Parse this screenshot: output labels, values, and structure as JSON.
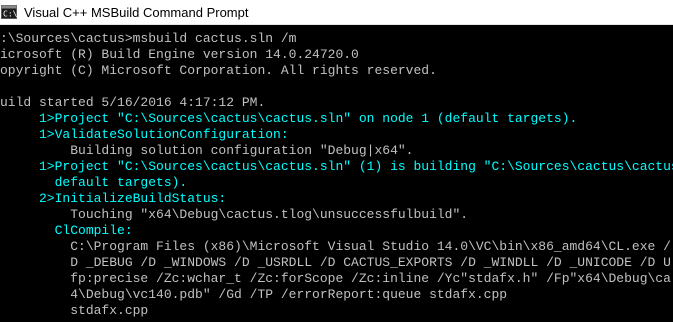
{
  "window": {
    "title": "Visual C++ MSBuild Command Prompt",
    "icon": "console-window-icon"
  },
  "colors": {
    "background": "#000000",
    "default_text": "#c0c0c0",
    "highlight_text": "#00ffff",
    "titlebar": "#ffffff"
  },
  "console": {
    "lines": [
      {
        "text": ":\\Sources\\cactus>msbuild cactus.sln /m",
        "style": "default"
      },
      {
        "text": "icrosoft (R) Build Engine version 14.0.24720.0",
        "style": "default"
      },
      {
        "text": "opyright (C) Microsoft Corporation. All rights reserved.",
        "style": "default"
      },
      {
        "text": "",
        "style": "default"
      },
      {
        "text": "uild started 5/16/2016 4:17:12 PM.",
        "style": "default"
      },
      {
        "text": "     1>Project \"C:\\Sources\\cactus\\cactus.sln\" on node 1 (default targets).",
        "style": "highlight"
      },
      {
        "text": "     1>ValidateSolutionConfiguration:",
        "style": "highlight"
      },
      {
        "text": "         Building solution configuration \"Debug|x64\".",
        "style": "default"
      },
      {
        "text": "     1>Project \"C:\\Sources\\cactus\\cactus.sln\" (1) is building \"C:\\Sources\\cactus\\cactus",
        "style": "highlight"
      },
      {
        "text": "       default targets).",
        "style": "highlight"
      },
      {
        "text": "     2>InitializeBuildStatus:",
        "style": "highlight"
      },
      {
        "text": "         Touching \"x64\\Debug\\cactus.tlog\\unsuccessfulbuild\".",
        "style": "default"
      },
      {
        "text": "       ClCompile:",
        "style": "highlight"
      },
      {
        "text": "         C:\\Program Files (x86)\\Microsoft Visual Studio 14.0\\VC\\bin\\x86_amd64\\CL.exe /",
        "style": "default"
      },
      {
        "text": "         D _DEBUG /D _WINDOWS /D _USRDLL /D CACTUS_EXPORTS /D _WINDLL /D _UNICODE /D U",
        "style": "default"
      },
      {
        "text": "         fp:precise /Zc:wchar_t /Zc:forScope /Zc:inline /Yc\"stdafx.h\" /Fp\"x64\\Debug\\ca",
        "style": "default"
      },
      {
        "text": "         4\\Debug\\vc140.pdb\" /Gd /TP /errorReport:queue stdafx.cpp",
        "style": "default"
      },
      {
        "text": "         stdafx.cpp",
        "style": "default"
      }
    ]
  }
}
